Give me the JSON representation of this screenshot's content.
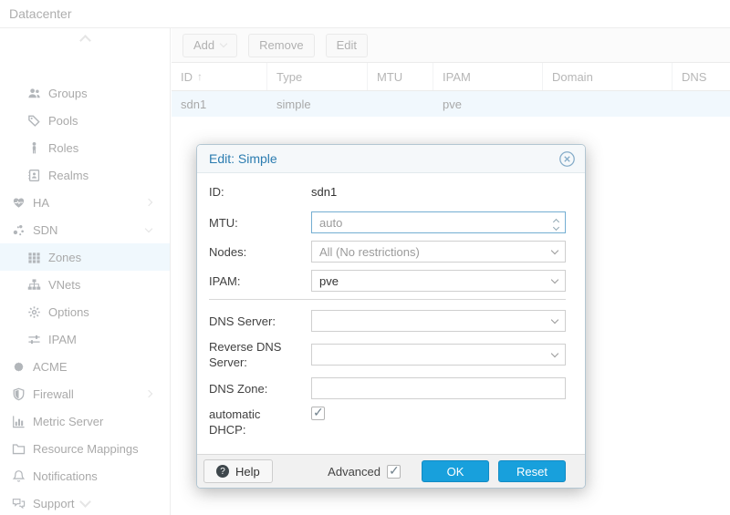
{
  "app": {
    "title": "Datacenter"
  },
  "sidebar": {
    "items": [
      {
        "label": "Groups",
        "icon": "users-icon",
        "level": 1,
        "selected": false
      },
      {
        "label": "Pools",
        "icon": "tags-icon",
        "level": 1,
        "selected": false
      },
      {
        "label": "Roles",
        "icon": "user-icon",
        "level": 1,
        "selected": false
      },
      {
        "label": "Realms",
        "icon": "address-book-icon",
        "level": 1,
        "selected": false
      },
      {
        "label": "HA",
        "icon": "heartbeat-icon",
        "level": 0,
        "selected": false,
        "expand": "collapsed"
      },
      {
        "label": "SDN",
        "icon": "sdn-nodes-icon",
        "level": 0,
        "selected": false,
        "expand": "expanded"
      },
      {
        "label": "Zones",
        "icon": "grid-icon",
        "level": 1,
        "selected": true
      },
      {
        "label": "VNets",
        "icon": "sitemap-icon",
        "level": 1,
        "selected": false
      },
      {
        "label": "Options",
        "icon": "gear-icon",
        "level": 1,
        "selected": false
      },
      {
        "label": "IPAM",
        "icon": "sliders-icon",
        "level": 1,
        "selected": false
      },
      {
        "label": "ACME",
        "icon": "certificate-icon",
        "level": 0,
        "selected": false
      },
      {
        "label": "Firewall",
        "icon": "shield-icon",
        "level": 0,
        "selected": false,
        "expand": "collapsed"
      },
      {
        "label": "Metric Server",
        "icon": "bar-chart-icon",
        "level": 0,
        "selected": false
      },
      {
        "label": "Resource Mappings",
        "icon": "folder-icon",
        "level": 0,
        "selected": false
      },
      {
        "label": "Notifications",
        "icon": "bell-icon",
        "level": 0,
        "selected": false
      },
      {
        "label": "Support",
        "icon": "comments-icon",
        "level": 0,
        "selected": false
      }
    ]
  },
  "toolbar": {
    "add": "Add",
    "remove": "Remove",
    "edit": "Edit"
  },
  "table": {
    "columns": [
      {
        "label": "ID",
        "sort": "asc"
      },
      {
        "label": "Type"
      },
      {
        "label": "MTU"
      },
      {
        "label": "IPAM"
      },
      {
        "label": "Domain"
      },
      {
        "label": "DNS"
      }
    ],
    "rows": [
      {
        "id": "sdn1",
        "type": "simple",
        "mtu": "",
        "ipam": "pve",
        "domain": "",
        "dns": ""
      }
    ]
  },
  "dialog": {
    "title": "Edit: Simple",
    "fields": {
      "id": {
        "label": "ID:",
        "value": "sdn1"
      },
      "mtu": {
        "label": "MTU:",
        "value": "",
        "placeholder": "auto"
      },
      "nodes": {
        "label": "Nodes:",
        "value": "",
        "placeholder": "All (No restrictions)"
      },
      "ipam": {
        "label": "IPAM:",
        "value": "pve"
      },
      "dns_server": {
        "label": "DNS Server:",
        "value": ""
      },
      "reverse_dns": {
        "label": "Reverse DNS Server:",
        "value": ""
      },
      "dns_zone": {
        "label": "DNS Zone:",
        "value": ""
      },
      "auto_dhcp": {
        "label": "automatic DHCP:",
        "checked": true
      }
    },
    "footer": {
      "help": "Help",
      "advanced": "Advanced",
      "advanced_checked": true,
      "ok": "OK",
      "reset": "Reset"
    }
  },
  "colors": {
    "accent_blue": "#18a0dc",
    "title_blue": "#2b7cb0",
    "selection_blue": "#dff0fa",
    "row_selection": "#e2f1fa",
    "focus_border": "#74aed2"
  }
}
